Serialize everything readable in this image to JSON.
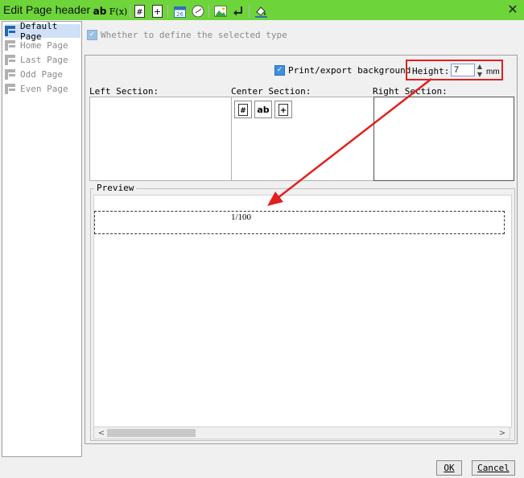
{
  "window": {
    "title": "Edit Page header",
    "close_glyph": "✕"
  },
  "sidebar": {
    "items": [
      {
        "label": "Default Page",
        "selected": true
      },
      {
        "label": "Home Page",
        "selected": false
      },
      {
        "label": "Last Page",
        "selected": false
      },
      {
        "label": "Odd Page",
        "selected": false
      },
      {
        "label": "Even Page",
        "selected": false
      }
    ]
  },
  "define_type": {
    "label": "Whether to define the selected type",
    "checked": true,
    "enabled": false
  },
  "toolbar": {
    "text_label": "ab",
    "formula_label": "F(x)",
    "page_number_label": "#",
    "total_pages_label": "+",
    "date_label": "26",
    "print_bg_label": "Print/export background",
    "print_bg_checked": true,
    "icons": [
      "text-icon",
      "formula-icon",
      "page-number-icon",
      "total-pages-icon",
      "date-icon",
      "time-icon",
      "image-icon",
      "line-break-icon",
      "background-fill-icon"
    ]
  },
  "height": {
    "label": "Height:",
    "value": "7",
    "unit": "mm"
  },
  "sections": {
    "left": "Left Section:",
    "center": "Center Section:",
    "right": "Right Section:",
    "center_controls": [
      "#",
      "ab",
      "+"
    ]
  },
  "preview": {
    "label": "Preview",
    "page_text": "1/100"
  },
  "scrollbar": {
    "left_arrow": "<",
    "right_arrow": ">"
  },
  "buttons": {
    "ok": "OK",
    "cancel": "Cancel"
  },
  "colors": {
    "titlebar": "#6dd53a",
    "annotation": "#e02020",
    "selection": "#cfe0f7",
    "check": "#3d8fe0"
  }
}
